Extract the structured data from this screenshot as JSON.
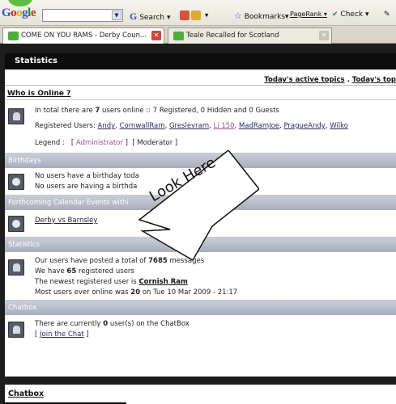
{
  "toolbar": {
    "logo": "Google",
    "search_button": "Search",
    "bookmarks": "Bookmarks",
    "pagerank": "PageRank",
    "check": "Check"
  },
  "tabs": [
    {
      "label": "COME ON YOU RAMS - Derby Coun..."
    },
    {
      "label": "Teale Recalled for Scotland"
    }
  ],
  "page": {
    "panel_title": "Statistics",
    "subhead_links": [
      "Today's active topics",
      ".",
      "Today's top"
    ],
    "who_online": {
      "heading": "Who is Online ?",
      "total_prefix": "In total there are ",
      "total_count": "7",
      "total_suffix": " users online :: 7 Registered, 0 Hidden and 0 Guests",
      "registered_label": "Registered Users:",
      "users": [
        "Andy",
        "CornwallRam",
        "Greslevram",
        "Li 150",
        "MadRamJoe",
        "PragueAndy",
        "Wilko"
      ],
      "legend_label": "Legend :",
      "legend_admin": "Administrator",
      "legend_mod": "Moderator"
    },
    "birthdays": {
      "bar": "Birthdays",
      "line1": "No users have a birthday toda",
      "line2": "No users are having a birthda"
    },
    "events": {
      "bar": "Forthcoming Calendar Events withi",
      "event": "Derby vs Barnsley"
    },
    "statistics": {
      "bar": "Statistics",
      "l1_prefix": "Our users have posted a total of ",
      "l1_value": "7685",
      "l1_suffix": " messages",
      "l2_prefix": "We have ",
      "l2_value": "65",
      "l2_suffix": " registered users",
      "l3_prefix": "The newest registered user is ",
      "l3_value": "Cornish Ram",
      "l4_prefix": "Most users ever online was ",
      "l4_value": "20",
      "l4_suffix": " on Tue 10 Mar 2009 - 21:17"
    },
    "chatbox": {
      "bar": "Chatbox",
      "line1_prefix": "There are currently ",
      "line1_value": "0",
      "line1_suffix": " user(s) on the ChatBox",
      "join": "Join the Chat"
    },
    "bottom_title": "Chatbox"
  },
  "callout": {
    "text": "Look Here"
  }
}
